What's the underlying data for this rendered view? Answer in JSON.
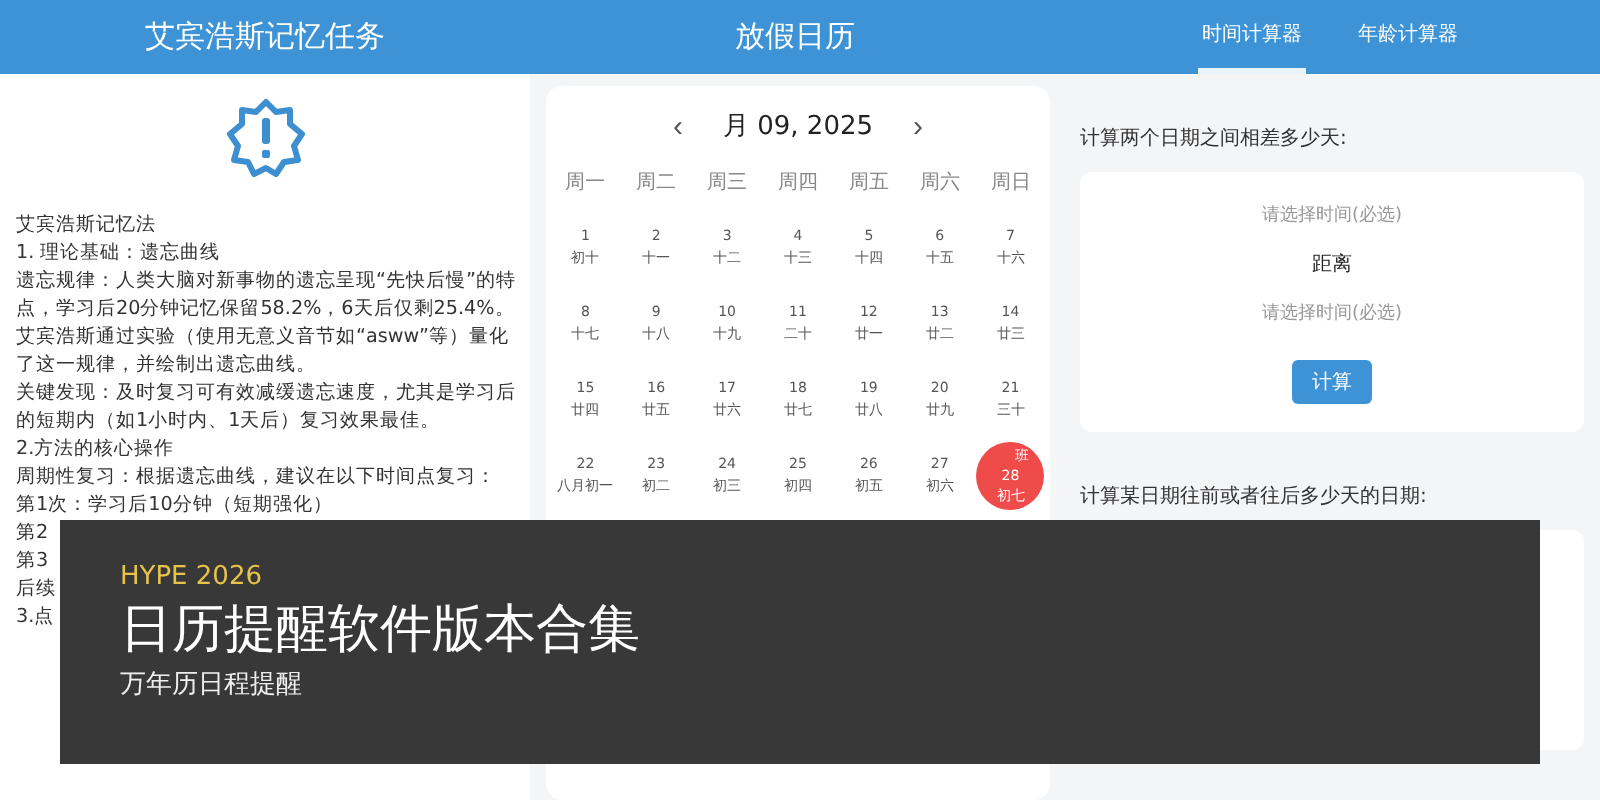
{
  "left": {
    "title": "艾宾浩斯记忆任务",
    "lines": [
      "艾宾浩斯记忆法",
      "1. 理论基础：遗忘曲线",
      "遗忘规律：人类大脑对新事物的遗忘呈现“先快后慢”的特点，学习后20分钟记忆保留58.2%，6天后仅剩25.4%。艾宾浩斯通过实验（使用无意义音节如“asww”等）量化了这一规律，并绘制出遗忘曲线。",
      "关键发现：及时复习可有效减缓遗忘速度，尤其是学习后的短期内（如1小时内、1天后）复习效果最佳。",
      "2.方法的核心操作",
      "周期性复习：根据遗忘曲线，建议在以下时间点复习：",
      "第1次：学习后10分钟（短期强化）",
      "第2",
      "第3",
      "后续",
      "3.点"
    ]
  },
  "calendar": {
    "title": "放假日历",
    "month": "月 09, 2025",
    "prev": "‹",
    "next": "›",
    "weekdays": [
      "周一",
      "周二",
      "周三",
      "周四",
      "周五",
      "周六",
      "周日"
    ],
    "days": [
      {
        "day": "1",
        "lunar": "初十",
        "kind": "normal"
      },
      {
        "day": "2",
        "lunar": "十一",
        "kind": "normal"
      },
      {
        "day": "3",
        "lunar": "十二",
        "kind": "normal"
      },
      {
        "day": "4",
        "lunar": "十三",
        "kind": "normal"
      },
      {
        "day": "5",
        "lunar": "十四",
        "kind": "normal"
      },
      {
        "day": "6",
        "lunar": "十五",
        "kind": "normal"
      },
      {
        "day": "7",
        "lunar": "十六",
        "kind": "normal"
      },
      {
        "day": "8",
        "lunar": "十七",
        "kind": "normal"
      },
      {
        "day": "9",
        "lunar": "十八",
        "kind": "normal"
      },
      {
        "day": "10",
        "lunar": "十九",
        "kind": "normal"
      },
      {
        "day": "11",
        "lunar": "二十",
        "kind": "normal"
      },
      {
        "day": "12",
        "lunar": "廿一",
        "kind": "normal"
      },
      {
        "day": "13",
        "lunar": "廿二",
        "kind": "normal"
      },
      {
        "day": "14",
        "lunar": "廿三",
        "kind": "normal"
      },
      {
        "day": "15",
        "lunar": "廿四",
        "kind": "normal"
      },
      {
        "day": "16",
        "lunar": "廿五",
        "kind": "normal"
      },
      {
        "day": "17",
        "lunar": "廿六",
        "kind": "normal"
      },
      {
        "day": "18",
        "lunar": "廿七",
        "kind": "normal"
      },
      {
        "day": "19",
        "lunar": "廿八",
        "kind": "normal"
      },
      {
        "day": "20",
        "lunar": "廿九",
        "kind": "normal"
      },
      {
        "day": "21",
        "lunar": "三十",
        "kind": "normal"
      },
      {
        "day": "22",
        "lunar": "八月初一",
        "kind": "normal"
      },
      {
        "day": "23",
        "lunar": "初二",
        "kind": "normal"
      },
      {
        "day": "24",
        "lunar": "初三",
        "kind": "normal"
      },
      {
        "day": "25",
        "lunar": "初四",
        "kind": "normal"
      },
      {
        "day": "26",
        "lunar": "初五",
        "kind": "normal"
      },
      {
        "day": "27",
        "lunar": "初六",
        "kind": "normal"
      },
      {
        "day": "28",
        "lunar": "初七",
        "kind": "work",
        "tag": "班"
      }
    ]
  },
  "right": {
    "tabs": [
      {
        "label": "时间计算器",
        "selected": true
      },
      {
        "label": "年龄计算器",
        "selected": false
      }
    ],
    "section1": "计算两个日期之间相差多少天:",
    "start_placeholder": "请选择时间(必选)",
    "between": "距离",
    "end_placeholder": "请选择时间(必选)",
    "button": "计算",
    "section2": "计算某日期往前或者往后多少天的日期:"
  },
  "overlay": {
    "kicker": "HYPE 2026",
    "title": "日历提醒软件版本合集",
    "subtitle": "万年历日程提醒"
  }
}
